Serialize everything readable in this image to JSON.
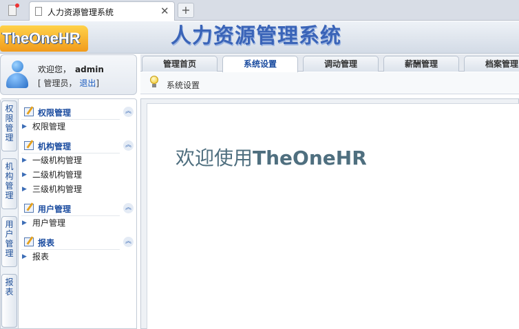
{
  "browser": {
    "tab_title": "人力资源管理系统",
    "close_glyph": "✕",
    "newtab_glyph": "+"
  },
  "header": {
    "logo_text": "TheOneHR",
    "banner_title": "人力资源管理系统"
  },
  "user": {
    "welcome": "欢迎您，",
    "name": "admin",
    "role_prefix": "[ 管理员，",
    "logout": "退出",
    "role_suffix": "]"
  },
  "vertical_tabs": [
    "权限管理",
    "机构管理",
    "用户管理",
    "报表"
  ],
  "menu": {
    "groups": [
      {
        "title": "权限管理",
        "items": [
          "权限管理"
        ]
      },
      {
        "title": "机构管理",
        "items": [
          "一级机构管理",
          "二级机构管理",
          "三级机构管理"
        ]
      },
      {
        "title": "用户管理",
        "items": [
          "用户管理"
        ]
      },
      {
        "title": "报表",
        "items": [
          "报表"
        ]
      }
    ]
  },
  "topnav": {
    "tabs": [
      "管理首页",
      "系统设置",
      "调动管理",
      "薪酬管理",
      "档案管理"
    ],
    "active": 1
  },
  "breadcrumb": "系统设置",
  "welcome_message": {
    "prefix": "欢迎使用",
    "brand": "TheOneHR"
  },
  "icons": {
    "collapse": "chevron-double-up-icon",
    "arrow": "triangle-right-icon",
    "bulb": "lightbulb-icon"
  }
}
